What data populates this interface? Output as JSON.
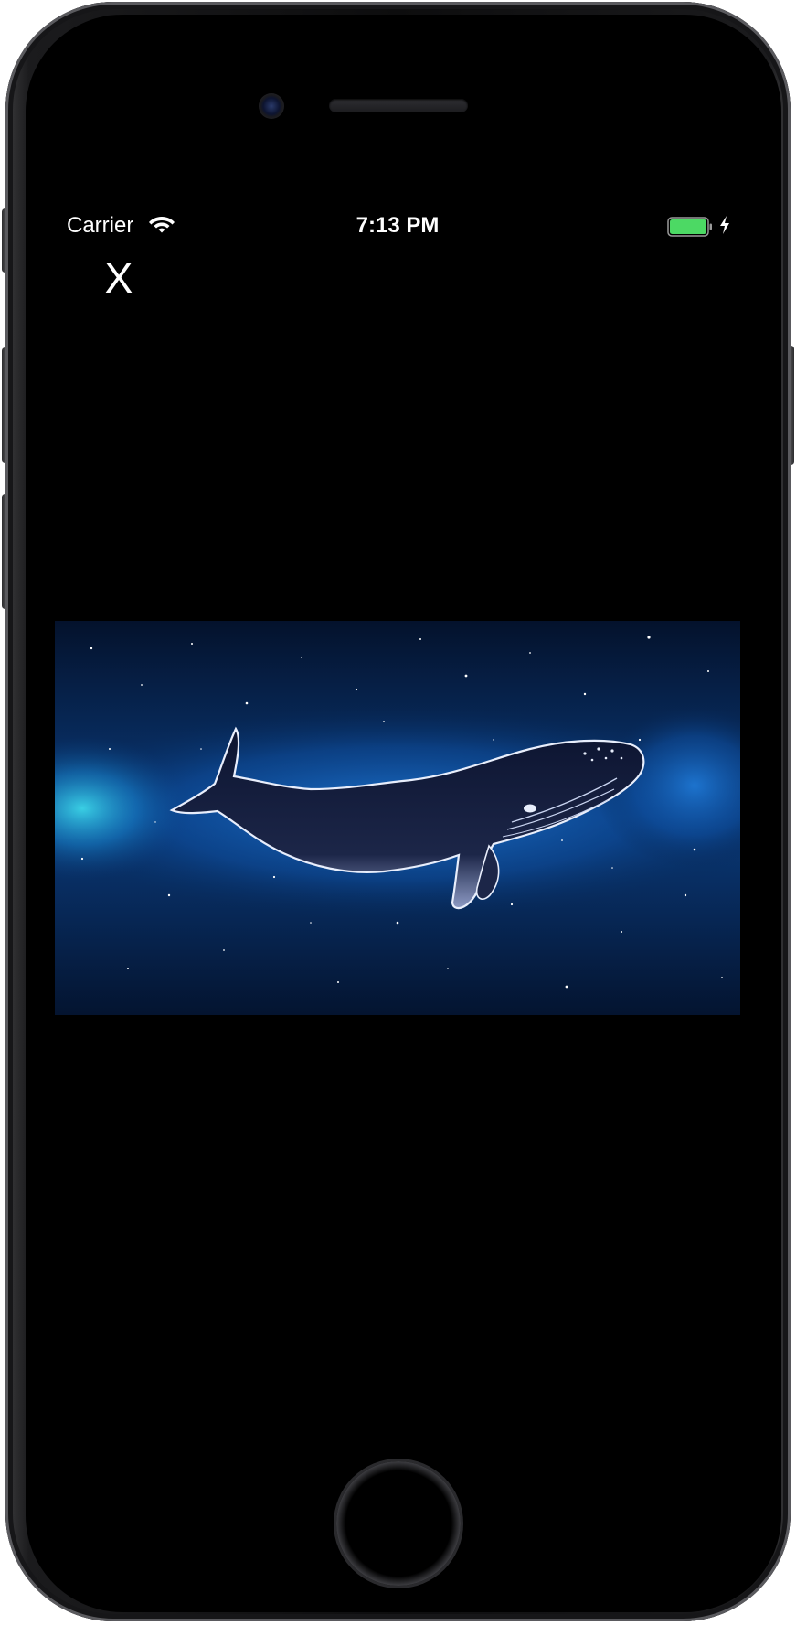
{
  "status_bar": {
    "carrier": "Carrier",
    "time": "7:13 PM",
    "wifi_icon": "wifi-icon",
    "battery_icon": "battery-full-icon",
    "battery_color": "#4cd964",
    "charging_icon": "charging-bolt-icon"
  },
  "toolbar": {
    "close_label": "X"
  },
  "content": {
    "image_icon": "whale-in-galaxy-image",
    "background_color": "#000000"
  }
}
